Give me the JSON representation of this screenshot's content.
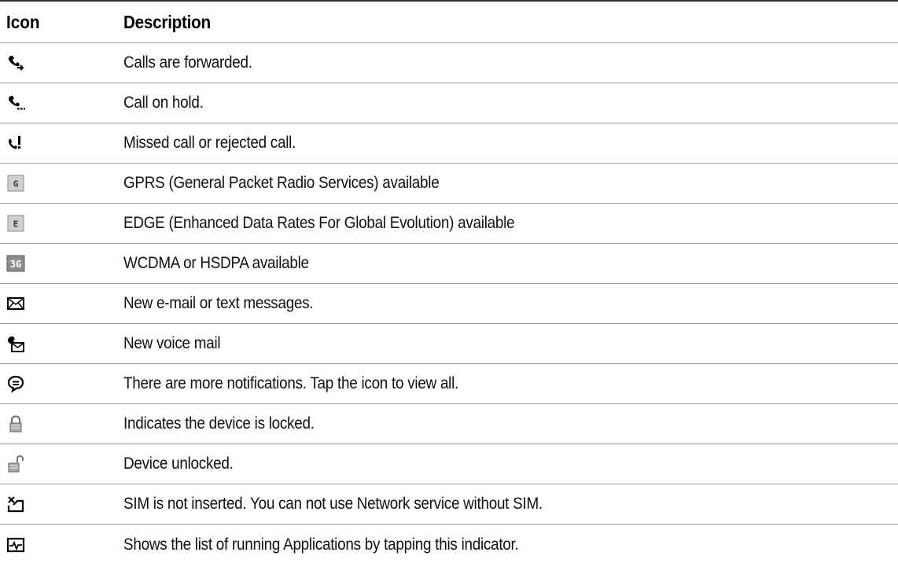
{
  "table": {
    "header": {
      "icon": "Icon",
      "description": "Description"
    },
    "rows": [
      {
        "icon": "calls-forwarded-icon",
        "description": "Calls are forwarded."
      },
      {
        "icon": "call-on-hold-icon",
        "description": "Call on hold."
      },
      {
        "icon": "missed-call-icon",
        "description": "Missed call or rejected call."
      },
      {
        "icon": "gprs-icon",
        "description": "GPRS (General Packet Radio Services) available"
      },
      {
        "icon": "edge-icon",
        "description": "EDGE (Enhanced Data Rates For Global Evolution) available"
      },
      {
        "icon": "3g-icon",
        "description": "WCDMA  or HSDPA available"
      },
      {
        "icon": "new-message-icon",
        "description": "New e-mail or text messages."
      },
      {
        "icon": "voice-mail-icon",
        "description": "New voice mail"
      },
      {
        "icon": "more-notifications-icon",
        "description": "There are more notifications. Tap the icon to view all."
      },
      {
        "icon": "device-locked-icon",
        "description": "Indicates the device is locked."
      },
      {
        "icon": "device-unlocked-icon",
        "description": "Device unlocked."
      },
      {
        "icon": "sim-missing-icon",
        "description": "SIM is not inserted. You can not use Network service without SIM."
      },
      {
        "icon": "running-apps-icon",
        "description": "Shows the list of running Applications by tapping this indicator."
      }
    ]
  }
}
